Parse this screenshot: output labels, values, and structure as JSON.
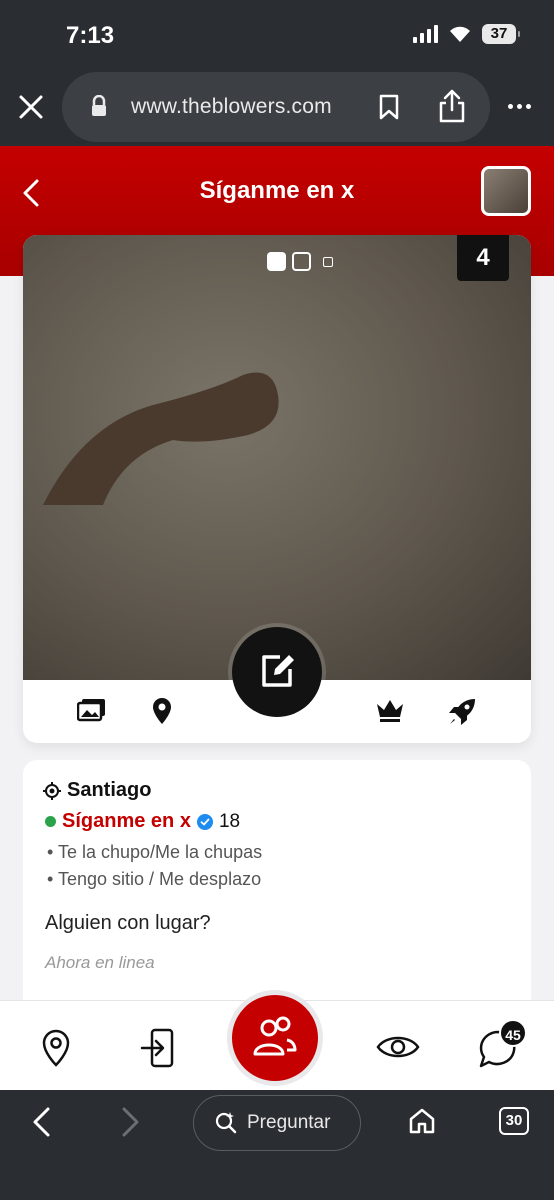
{
  "status_bar": {
    "time": "7:13",
    "battery": "37"
  },
  "browser": {
    "url": "www.theblowers.com",
    "ask_label": "Preguntar",
    "tab_count": "30"
  },
  "header": {
    "title": "Síganme en x"
  },
  "profile_card": {
    "photo_count": "4",
    "photo_pages": 3,
    "active_photo": 1
  },
  "info": {
    "city": "Santiago",
    "name": "Síganme en x",
    "age": "18",
    "tags": [
      "• Te la chupo/Me la chupas",
      "• Tengo sitio / Me desplazo"
    ],
    "description": "Alguien con lugar?",
    "last_seen": "Ahora en linea"
  },
  "bottom_nav": {
    "messages_badge": "45"
  },
  "colors": {
    "brand_red": "#c40000",
    "online_green": "#2ca34b",
    "verified_blue": "#1d8cf0",
    "chrome_dark": "#2a2d31"
  }
}
